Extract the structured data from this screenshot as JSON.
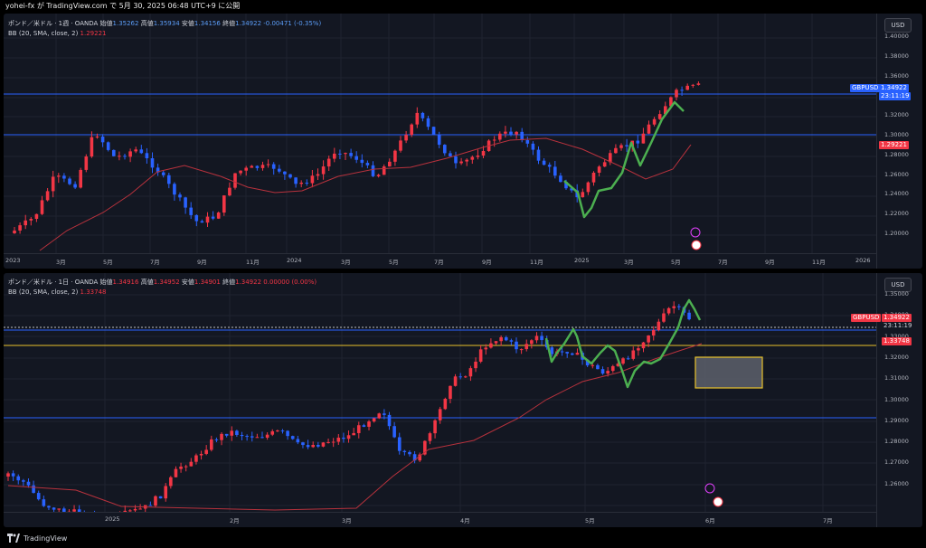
{
  "header": {
    "publish_line": "yohei-fx が TradingView.com で 5月 30, 2025 06:48 UTC+9 に公開"
  },
  "colors": {
    "up": "#f23645",
    "down": "#2962ff",
    "bb": "#b8323d",
    "wave": "#4caf50",
    "hline": "#2962ff",
    "yellow": "#e8c22b"
  },
  "pane1": {
    "legend": {
      "title": "ポンド／米ドル · 1週 · OANDA",
      "o_label": "始値",
      "o": "1.35262",
      "h_label": "高値",
      "h": "1.35934",
      "l_label": "安値",
      "l": "1.34156",
      "c_label": "終値",
      "c": "1.34922",
      "chg": "-0.00471 (-0.35%)",
      "bb_label": "BB (20, SMA, close, 2)",
      "bb_value": "1.29221"
    },
    "currency": "USD",
    "y_ticks": [
      "1.40000",
      "1.38000",
      "1.36000",
      "1.34000",
      "1.32000",
      "1.30000",
      "1.28000",
      "1.26000",
      "1.24000",
      "1.22000",
      "1.20000"
    ],
    "x_ticks": [
      "2023",
      "3月",
      "5月",
      "7月",
      "9月",
      "11月",
      "2024",
      "3月",
      "5月",
      "7月",
      "9月",
      "11月",
      "2025",
      "3月",
      "5月",
      "7月",
      "9月",
      "11月",
      "2026"
    ],
    "symbol_tag": "GBPUSD",
    "price_tag": "1.34922",
    "countdown": "23:11:19",
    "bb_tag": "1.29221"
  },
  "pane2": {
    "legend": {
      "title": "ポンド／米ドル · 1日 · OANDA",
      "o_label": "始値",
      "o": "1.34916",
      "h_label": "高値",
      "h": "1.34952",
      "l_label": "安値",
      "l": "1.34901",
      "c_label": "終値",
      "c": "1.34922",
      "chg": "0.00000 (0.00%)",
      "bb_label": "BB (20, SMA, close, 2)",
      "bb_value": "1.33748"
    },
    "currency": "USD",
    "y_ticks": [
      "1.35000",
      "1.34000",
      "1.33000",
      "1.32000",
      "1.31000",
      "1.30000",
      "1.29000",
      "1.28000",
      "1.27000",
      "1.26000"
    ],
    "x_ticks": [
      "2025",
      "2月",
      "3月",
      "4月",
      "5月",
      "6月",
      "7月"
    ],
    "symbol_tag": "GBPUSD",
    "price_tag": "1.34922",
    "countdown": "23:11:19",
    "bb_tag": "1.33748"
  },
  "footer": {
    "brand": "TradingView"
  }
}
